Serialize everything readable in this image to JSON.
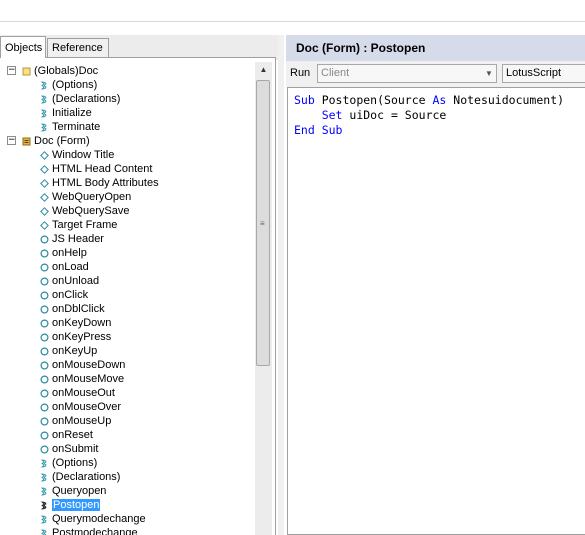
{
  "tabs": [
    "Objects",
    "Reference"
  ],
  "header": {
    "title": "Doc (Form) : Postopen"
  },
  "run_bar": {
    "label": "Run",
    "client": "Client",
    "language": "LotusScript"
  },
  "tree": [
    {
      "label": "(Globals)Doc",
      "kind": "folder",
      "expander": "−"
    },
    {
      "label": "(Options)",
      "kind": "script"
    },
    {
      "label": "(Declarations)",
      "kind": "script"
    },
    {
      "label": "Initialize",
      "kind": "script"
    },
    {
      "label": "Terminate",
      "kind": "script"
    },
    {
      "label": "Doc (Form)",
      "kind": "form",
      "expander": "−"
    },
    {
      "label": "Window Title",
      "kind": "formula"
    },
    {
      "label": "HTML Head Content",
      "kind": "formula"
    },
    {
      "label": "HTML Body Attributes",
      "kind": "formula"
    },
    {
      "label": "WebQueryOpen",
      "kind": "formula"
    },
    {
      "label": "WebQuerySave",
      "kind": "formula"
    },
    {
      "label": "Target Frame",
      "kind": "formula"
    },
    {
      "label": "JS Header",
      "kind": "event"
    },
    {
      "label": "onHelp",
      "kind": "event"
    },
    {
      "label": "onLoad",
      "kind": "event"
    },
    {
      "label": "onUnload",
      "kind": "event"
    },
    {
      "label": "onClick",
      "kind": "event"
    },
    {
      "label": "onDblClick",
      "kind": "event"
    },
    {
      "label": "onKeyDown",
      "kind": "event"
    },
    {
      "label": "onKeyPress",
      "kind": "event"
    },
    {
      "label": "onKeyUp",
      "kind": "event"
    },
    {
      "label": "onMouseDown",
      "kind": "event"
    },
    {
      "label": "onMouseMove",
      "kind": "event"
    },
    {
      "label": "onMouseOut",
      "kind": "event"
    },
    {
      "label": "onMouseOver",
      "kind": "event"
    },
    {
      "label": "onMouseUp",
      "kind": "event"
    },
    {
      "label": "onReset",
      "kind": "event"
    },
    {
      "label": "onSubmit",
      "kind": "event"
    },
    {
      "label": "(Options)",
      "kind": "script"
    },
    {
      "label": "(Declarations)",
      "kind": "script"
    },
    {
      "label": "Queryopen",
      "kind": "script"
    },
    {
      "label": "Postopen",
      "kind": "script-dark",
      "selected": true
    },
    {
      "label": "Querymodechange",
      "kind": "script"
    },
    {
      "label": "Postmodechange",
      "kind": "script"
    }
  ],
  "code": [
    [
      {
        "t": "Sub",
        "kw": true
      },
      {
        "t": " Postopen(Source "
      },
      {
        "t": "As",
        "kw": true
      },
      {
        "t": " Notesuidocument)"
      }
    ],
    [
      {
        "t": "    "
      },
      {
        "t": "Set",
        "kw": true
      },
      {
        "t": " uiDoc = Source"
      }
    ],
    [
      {
        "t": "End Sub",
        "kw": true
      }
    ]
  ],
  "colors": {
    "keyword": "#0000ff",
    "header_bg": "#d6dbe9",
    "selection": "#3399ff"
  }
}
